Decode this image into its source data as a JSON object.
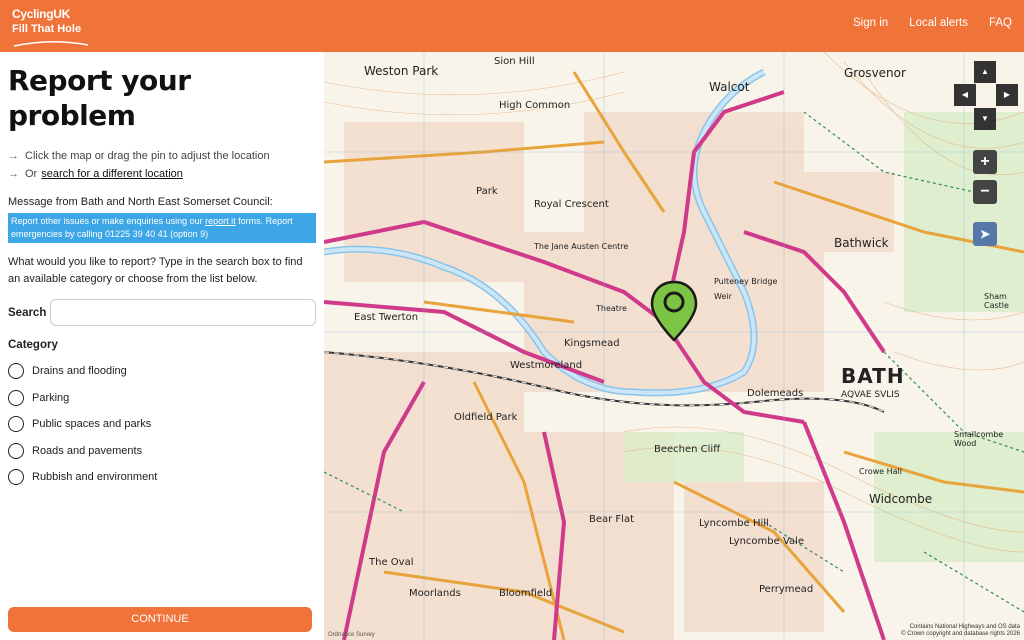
{
  "header": {
    "brand_top": "CyclingUK",
    "brand_bottom": "Fill That Hole",
    "nav": [
      "Sign in",
      "Local alerts",
      "FAQ"
    ]
  },
  "page": {
    "title_line1": "Report your",
    "title_line2": "problem",
    "hint": "Click the map or drag the pin to adjust the location",
    "or_text": "Or",
    "search_link": "search for a different location",
    "message_title": "Message from Bath and North East Somerset Council:",
    "message_part1": "Report other issues or make enquiries using our",
    "message_link": "report it",
    "message_part2": "forms. Report emergencies by calling 01225 39 40 41 (option 9)",
    "prompt": "What would you like to report? Type in the search box to find an available category or choose from the list below.",
    "search_label": "Search",
    "search_value": "",
    "category_label": "Category",
    "categories": [
      "Drains and flooding",
      "Parking",
      "Public spaces and parks",
      "Roads and pavements",
      "Rubbish and environment"
    ],
    "continue": "CONTINUE"
  },
  "map": {
    "places": [
      "Weston Park",
      "Sion Hill",
      "Walcot",
      "Grosvenor",
      "High Common",
      "Royal Crescent",
      "Park",
      "The Jane Austen Centre",
      "Bathwick",
      "Pulteney Bridge",
      "Weir",
      "Theatre",
      "Kingsmead",
      "East Twerton",
      "Westmoreland",
      "Oldfield Park",
      "Dolemeads",
      "BATH",
      "AQVAE SVLIS",
      "Sham Castle",
      "Smallcombe Wood",
      "Beechen Cliff",
      "Crowe Hall",
      "Widcombe",
      "Lyncombe Hill",
      "Lyncombe Vale",
      "Bear Flat",
      "Perrymead",
      "Moorlands",
      "Bloomfield",
      "The Oval"
    ],
    "attribution_1": "Contains National Highways and OS data",
    "attribution_2": "© Crown copyright and database rights 2026",
    "os_logo": "Ordnance Survey",
    "zoom_in": "+",
    "zoom_out": "−",
    "pan_up": "▲",
    "pan_left": "◀",
    "pan_right": "▶",
    "pan_down": "▼",
    "locate": "➤"
  },
  "colors": {
    "brand_orange": "#f0733a",
    "message_blue": "#3da6e6",
    "pin_green": "#7cc443"
  }
}
